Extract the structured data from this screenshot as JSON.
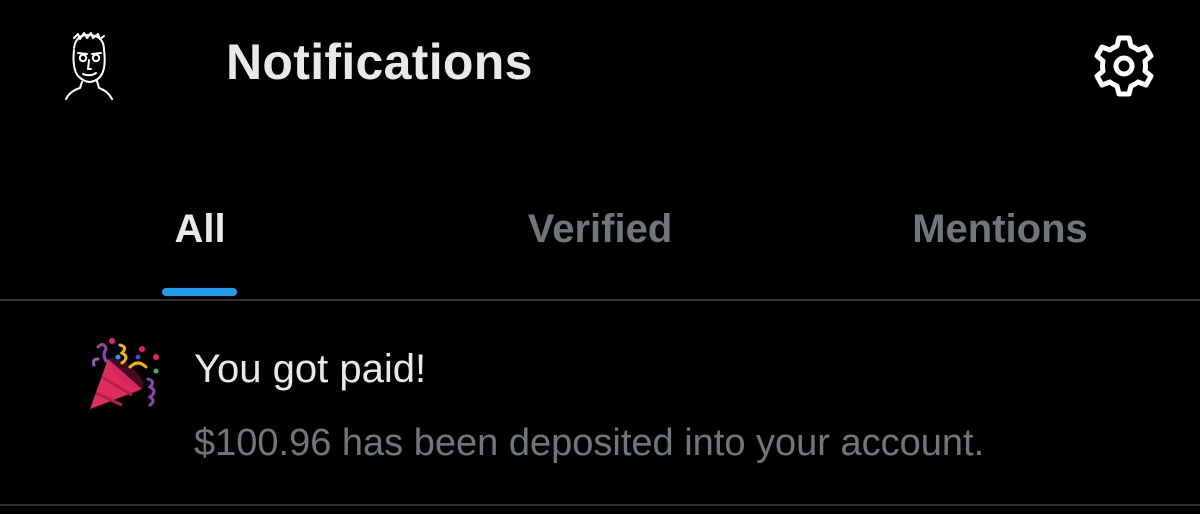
{
  "header": {
    "title": "Notifications",
    "avatar_icon": "profile-avatar-sketch",
    "settings_icon": "gear-icon"
  },
  "tabs": [
    {
      "label": "All",
      "active": true
    },
    {
      "label": "Verified",
      "active": false
    },
    {
      "label": "Mentions",
      "active": false
    }
  ],
  "notifications": [
    {
      "icon": "party-popper-icon",
      "title": "You got paid!",
      "body": "$100.96 has been deposited into your account."
    }
  ],
  "colors": {
    "background": "#000000",
    "primary_text": "#e7e9ea",
    "secondary_text": "#71767b",
    "accent": "#1d9bf0",
    "divider": "#2f3336"
  }
}
